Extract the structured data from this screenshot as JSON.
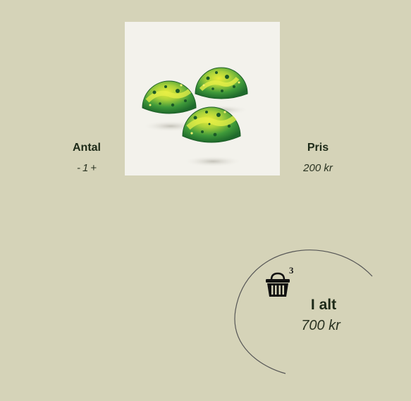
{
  "product": {
    "image_alt": "Three green and yellow speckled chocolate domes"
  },
  "quantity": {
    "label": "Antal",
    "decrement": "-",
    "value": "1",
    "increment": "+"
  },
  "price": {
    "label": "Pris",
    "value": "200 kr"
  },
  "cart": {
    "icon": "basket-icon",
    "count": "3",
    "total_label": "I alt",
    "total_value": "700 kr"
  },
  "colors": {
    "background": "#d5d3b8",
    "image_background": "#f3f2ec",
    "text_dark": "#1d2a18",
    "arc": "#555555"
  }
}
